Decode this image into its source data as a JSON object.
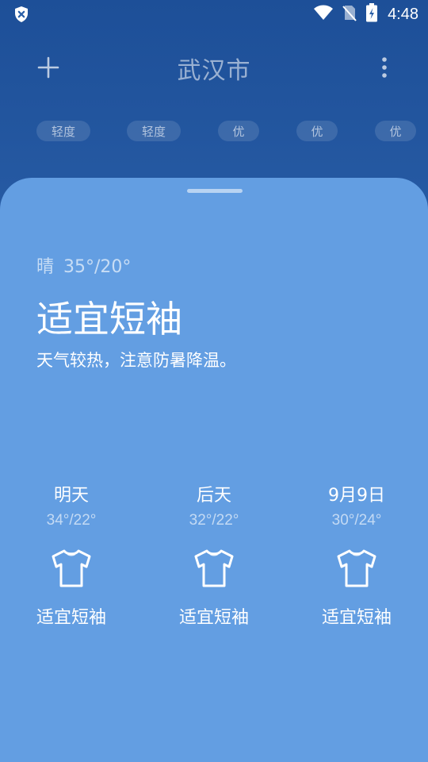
{
  "status_bar": {
    "time": "4:48",
    "icons": [
      "shield-x-icon",
      "wifi-icon",
      "no-sim-icon",
      "battery-charging-icon"
    ]
  },
  "header": {
    "city": "武汉市",
    "add_icon": "plus-icon",
    "more_icon": "more-vertical-icon"
  },
  "aqi_chips": [
    {
      "label": "轻度"
    },
    {
      "label": "轻度"
    },
    {
      "label": "优"
    },
    {
      "label": "优"
    },
    {
      "label": "优"
    }
  ],
  "today": {
    "condition": "晴",
    "temp_range": "35°/20°",
    "headline": "适宜短袖",
    "tip": "天气较热，注意防暑降温。"
  },
  "forecast": [
    {
      "day": "明天",
      "temp": "34°/22°",
      "icon": "tshirt-icon",
      "advice": "适宜短袖"
    },
    {
      "day": "后天",
      "temp": "32°/22°",
      "icon": "tshirt-icon",
      "advice": "适宜短袖"
    },
    {
      "day": "9月9日",
      "temp": "30°/24°",
      "icon": "tshirt-icon",
      "advice": "适宜短袖"
    }
  ],
  "colors": {
    "header_bg": "#2a5fa8",
    "sheet_bg": "#639ee2",
    "text": "#ffffff"
  }
}
